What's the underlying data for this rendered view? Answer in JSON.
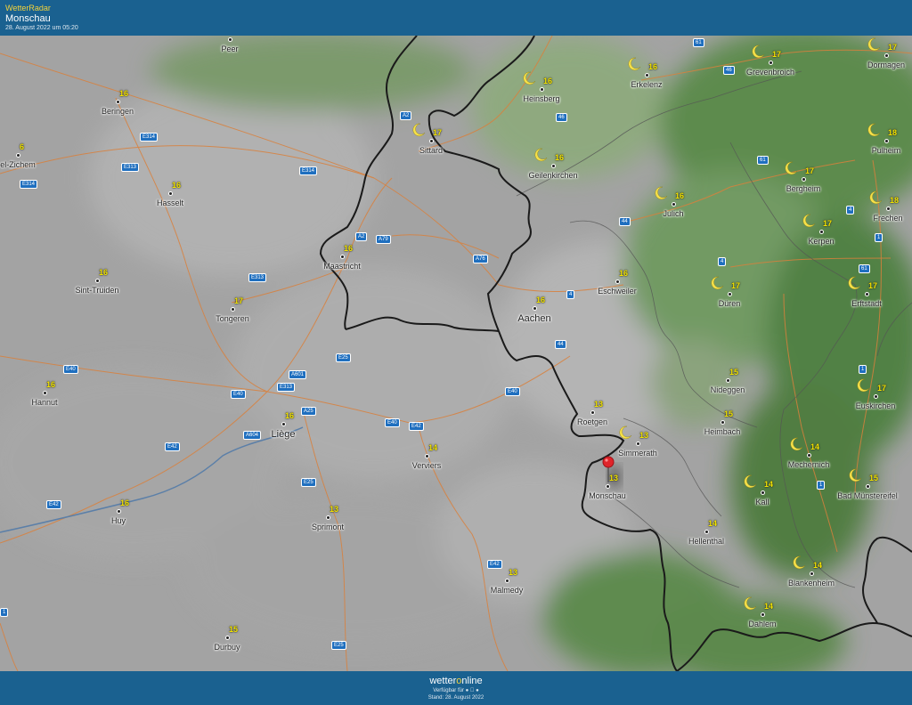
{
  "header": {
    "brand": "WetterRadar",
    "location": "Monschau",
    "timestamp": "28. August 2022 um 05:20"
  },
  "footer": {
    "logo_left": "wetter",
    "logo_o": "o",
    "logo_right": "nline",
    "available": "Verfügbar für",
    "stand": "Stand: 28. August 2022"
  },
  "cities": [
    {
      "id": "peer",
      "name": "Peer",
      "temp": "",
      "moon": false
    },
    {
      "id": "beringen",
      "name": "Beringen",
      "temp": "16",
      "moon": false
    },
    {
      "id": "heinsberg",
      "name": "Heinsberg",
      "temp": "16",
      "moon": true
    },
    {
      "id": "erkelenz",
      "name": "Erkelenz",
      "temp": "16",
      "moon": true
    },
    {
      "id": "grevenbroich",
      "name": "Grevenbroich",
      "temp": "17",
      "moon": true
    },
    {
      "id": "dormagen",
      "name": "Dormagen",
      "temp": "17",
      "moon": true
    },
    {
      "id": "zichem",
      "name": "el-Zichem",
      "temp": "6",
      "moon": false
    },
    {
      "id": "sittard",
      "name": "Sittard",
      "temp": "17",
      "moon": true
    },
    {
      "id": "pulheim",
      "name": "Pulheim",
      "temp": "18",
      "moon": true
    },
    {
      "id": "geilenkirchen",
      "name": "Geilenkirchen",
      "temp": "16",
      "moon": true
    },
    {
      "id": "hasselt",
      "name": "Hasselt",
      "temp": "16",
      "moon": false
    },
    {
      "id": "bergheim",
      "name": "Bergheim",
      "temp": "17",
      "moon": true
    },
    {
      "id": "julich",
      "name": "Julich",
      "temp": "16",
      "moon": true
    },
    {
      "id": "frechen",
      "name": "Frechen",
      "temp": "18",
      "moon": true
    },
    {
      "id": "kerpen",
      "name": "Kerpen",
      "temp": "17",
      "moon": true
    },
    {
      "id": "maastricht",
      "name": "Maastricht",
      "temp": "16",
      "moon": false
    },
    {
      "id": "sinttruiden",
      "name": "Sint-Truiden",
      "temp": "16",
      "moon": false
    },
    {
      "id": "eschweiler",
      "name": "Eschweiler",
      "temp": "16",
      "moon": false
    },
    {
      "id": "duren",
      "name": "Düren",
      "temp": "17",
      "moon": true
    },
    {
      "id": "erftstadt",
      "name": "Erftstadt",
      "temp": "17",
      "moon": true
    },
    {
      "id": "tongeren",
      "name": "Tongeren",
      "temp": "17",
      "moon": false
    },
    {
      "id": "aachen",
      "name": "Aachen",
      "temp": "16",
      "moon": false,
      "big": true
    },
    {
      "id": "hannut",
      "name": "Hannut",
      "temp": "16",
      "moon": false
    },
    {
      "id": "nideggen",
      "name": "Nideggen",
      "temp": "15",
      "moon": false
    },
    {
      "id": "euskirchen",
      "name": "Euskirchen",
      "temp": "17",
      "moon": true
    },
    {
      "id": "roetgen",
      "name": "Roetgen",
      "temp": "13",
      "moon": false
    },
    {
      "id": "liege",
      "name": "Liège",
      "temp": "16",
      "moon": false,
      "big": true
    },
    {
      "id": "heimbach",
      "name": "Heimbach",
      "temp": "15",
      "moon": false
    },
    {
      "id": "simmerath",
      "name": "Simmerath",
      "temp": "13",
      "moon": true
    },
    {
      "id": "verviers",
      "name": "Verviers",
      "temp": "14",
      "moon": false
    },
    {
      "id": "mechernich",
      "name": "Mechernich",
      "temp": "14",
      "moon": true
    },
    {
      "id": "monschau",
      "name": "Monschau",
      "temp": "13",
      "moon": false
    },
    {
      "id": "badmuenstereifel",
      "name": "Bad Münstereifel",
      "temp": "15",
      "moon": true
    },
    {
      "id": "huy",
      "name": "Huy",
      "temp": "16",
      "moon": false
    },
    {
      "id": "kall",
      "name": "Kall",
      "temp": "14",
      "moon": true
    },
    {
      "id": "sprimont",
      "name": "Sprimont",
      "temp": "13",
      "moon": false
    },
    {
      "id": "hellenthal",
      "name": "Hellenthal",
      "temp": "14",
      "moon": false
    },
    {
      "id": "blankenheim",
      "name": "Blankenheim",
      "temp": "14",
      "moon": true
    },
    {
      "id": "malmedy",
      "name": "Malmedy",
      "temp": "13",
      "moon": false
    },
    {
      "id": "dahlem",
      "name": "Dahlem",
      "temp": "14",
      "moon": true
    },
    {
      "id": "durbuy",
      "name": "Durbuy",
      "temp": "15",
      "moon": false
    }
  ],
  "roads": [
    {
      "id": "r61a",
      "label": "61"
    },
    {
      "id": "r46a",
      "label": "46"
    },
    {
      "id": "a2a",
      "label": "A2"
    },
    {
      "id": "r46b",
      "label": "46"
    },
    {
      "id": "e314a",
      "label": "E314"
    },
    {
      "id": "e313a",
      "label": "E313"
    },
    {
      "id": "e314b",
      "label": "E314"
    },
    {
      "id": "e314c",
      "label": "E314"
    },
    {
      "id": "r61b",
      "label": "61"
    },
    {
      "id": "r4a",
      "label": "4"
    },
    {
      "id": "r44a",
      "label": "44"
    },
    {
      "id": "r1a",
      "label": "1"
    },
    {
      "id": "a2b",
      "label": "A2"
    },
    {
      "id": "a79",
      "label": "A79"
    },
    {
      "id": "a76",
      "label": "A76"
    },
    {
      "id": "r4b",
      "label": "4"
    },
    {
      "id": "r61c",
      "label": "61"
    },
    {
      "id": "e313b",
      "label": "E313"
    },
    {
      "id": "r4c",
      "label": "4"
    },
    {
      "id": "r44b",
      "label": "44"
    },
    {
      "id": "e25a",
      "label": "E25"
    },
    {
      "id": "e40a",
      "label": "E40"
    },
    {
      "id": "a601",
      "label": "A601"
    },
    {
      "id": "r1b",
      "label": "1"
    },
    {
      "id": "e313c",
      "label": "E313"
    },
    {
      "id": "e40b",
      "label": "E40"
    },
    {
      "id": "e40c",
      "label": "E40"
    },
    {
      "id": "a25",
      "label": "A25"
    },
    {
      "id": "e40d",
      "label": "E40"
    },
    {
      "id": "e42a",
      "label": "E42"
    },
    {
      "id": "a604",
      "label": "A604"
    },
    {
      "id": "e42b",
      "label": "E42"
    },
    {
      "id": "r1c",
      "label": "1"
    },
    {
      "id": "e25b",
      "label": "E25"
    },
    {
      "id": "e42c",
      "label": "E42"
    },
    {
      "id": "e42d",
      "label": "E42"
    },
    {
      "id": "r1d",
      "label": "1"
    },
    {
      "id": "e25c",
      "label": "E25"
    }
  ]
}
